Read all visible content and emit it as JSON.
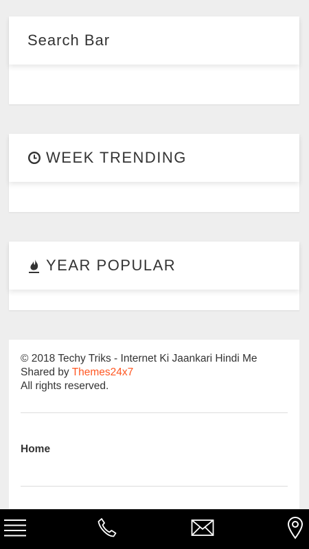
{
  "search": {
    "title": "Search Bar"
  },
  "week_trending": {
    "title": "WEEK TRENDING",
    "icon": "clock-icon"
  },
  "year_popular": {
    "title": "YEAR POPULAR",
    "icon": "fire-icon"
  },
  "footer": {
    "copyright": "© 2018 Techy Triks - Internet Ki Jaankari Hindi Me",
    "shared_prefix": "Shared by ",
    "shared_link": "Themes24x7",
    "rights": "All rights reserved.",
    "home_link": "Home",
    "accent_color": "#ff5722"
  },
  "bottom_bar": {
    "items": [
      {
        "icon": "menu-icon"
      },
      {
        "icon": "phone-icon"
      },
      {
        "icon": "mail-icon"
      },
      {
        "icon": "location-pin-icon"
      }
    ],
    "background": "#000000"
  }
}
